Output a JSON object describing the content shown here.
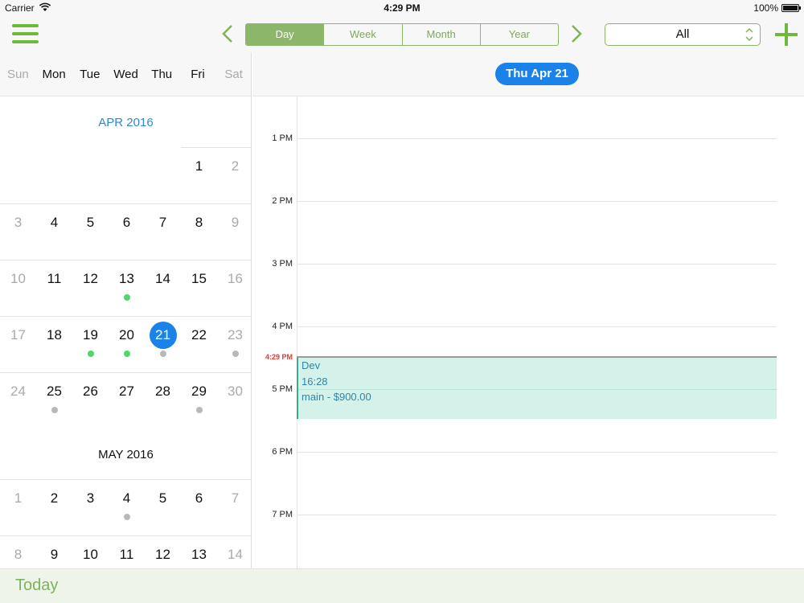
{
  "status_bar": {
    "carrier": "Carrier",
    "time": "4:29 PM",
    "battery": "100%"
  },
  "toolbar": {
    "views": [
      "Day",
      "Week",
      "Month",
      "Year"
    ],
    "active_view": "Day",
    "filter": "All",
    "accent_color": "#6fb83c"
  },
  "weekdays": [
    "Sun",
    "Mon",
    "Tue",
    "Wed",
    "Thu",
    "Fri",
    "Sat"
  ],
  "months": [
    {
      "title": "APR 2016",
      "current": true,
      "weeks": [
        [
          null,
          null,
          null,
          null,
          null,
          {
            "d": "1"
          },
          {
            "d": "2"
          }
        ],
        [
          {
            "d": "3"
          },
          {
            "d": "4"
          },
          {
            "d": "5"
          },
          {
            "d": "6"
          },
          {
            "d": "7"
          },
          {
            "d": "8"
          },
          {
            "d": "9"
          }
        ],
        [
          {
            "d": "10"
          },
          {
            "d": "11"
          },
          {
            "d": "12"
          },
          {
            "d": "13",
            "dot": "green"
          },
          {
            "d": "14"
          },
          {
            "d": "15"
          },
          {
            "d": "16"
          }
        ],
        [
          {
            "d": "17"
          },
          {
            "d": "18"
          },
          {
            "d": "19",
            "dot": "green"
          },
          {
            "d": "20",
            "dot": "green"
          },
          {
            "d": "21",
            "dot": "gray",
            "selected": true
          },
          {
            "d": "22"
          },
          {
            "d": "23",
            "dot": "gray"
          }
        ],
        [
          {
            "d": "24"
          },
          {
            "d": "25",
            "dot": "gray"
          },
          {
            "d": "26"
          },
          {
            "d": "27"
          },
          {
            "d": "28"
          },
          {
            "d": "29",
            "dot": "gray"
          },
          {
            "d": "30"
          }
        ]
      ]
    },
    {
      "title": "MAY 2016",
      "current": false,
      "weeks": [
        [
          {
            "d": "1"
          },
          {
            "d": "2"
          },
          {
            "d": "3"
          },
          {
            "d": "4",
            "dot": "gray"
          },
          {
            "d": "5"
          },
          {
            "d": "6"
          },
          {
            "d": "7"
          }
        ],
        [
          {
            "d": "8"
          },
          {
            "d": "9"
          },
          {
            "d": "10"
          },
          {
            "d": "11"
          },
          {
            "d": "12"
          },
          {
            "d": "13"
          },
          {
            "d": "14"
          }
        ]
      ]
    }
  ],
  "day_view": {
    "date_label": "Thu Apr 21",
    "hours": [
      "1 PM",
      "2 PM",
      "3 PM",
      "4 PM",
      "5 PM",
      "6 PM",
      "7 PM"
    ],
    "now_label": "4:29 PM",
    "event": {
      "title": "Dev",
      "time": "16:28",
      "detail": "main - $900.00"
    }
  },
  "footer": {
    "today_label": "Today"
  }
}
